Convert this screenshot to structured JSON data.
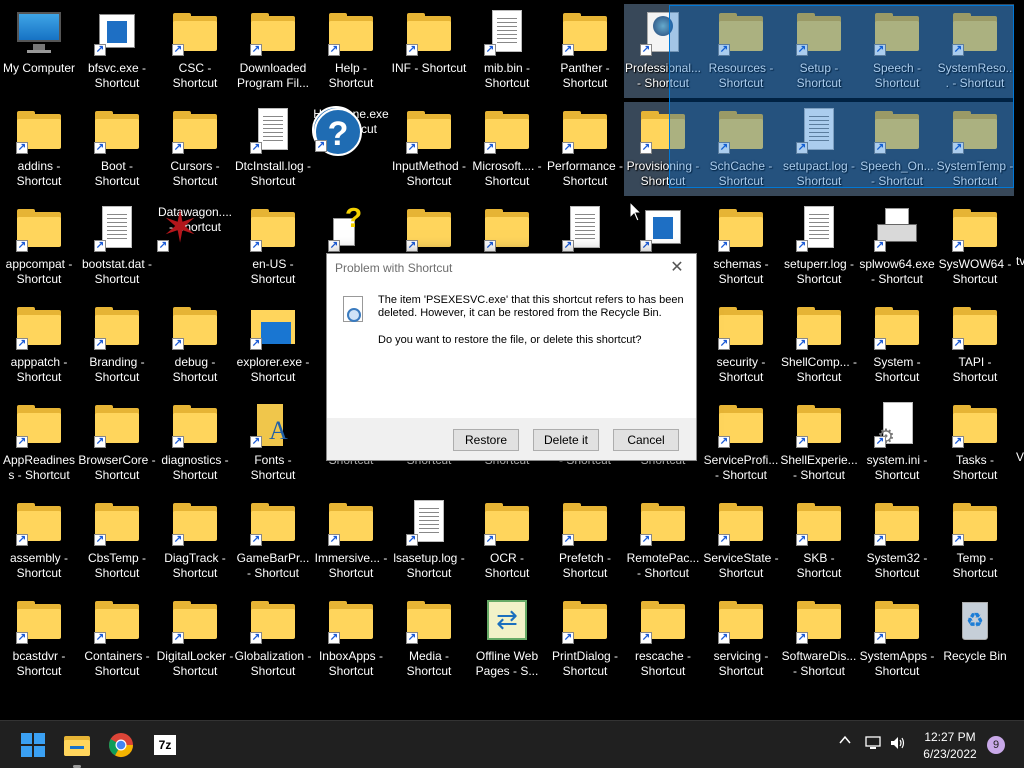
{
  "desktop": {
    "icons": [
      {
        "label": "My Computer",
        "kind": "mycomp",
        "shortcut": false
      },
      {
        "label": "bfsvc.exe - Shortcut",
        "kind": "appwin",
        "shortcut": true
      },
      {
        "label": "CSC - Shortcut",
        "kind": "folder",
        "shortcut": true
      },
      {
        "label": "Downloaded Program Fil...",
        "kind": "folder",
        "shortcut": true
      },
      {
        "label": "Help - Shortcut",
        "kind": "folder",
        "shortcut": true
      },
      {
        "label": "INF - Shortcut",
        "kind": "folder",
        "shortcut": true
      },
      {
        "label": "mib.bin - Shortcut",
        "kind": "doc",
        "shortcut": true
      },
      {
        "label": "Panther - Shortcut",
        "kind": "folder",
        "shortcut": true
      },
      {
        "label": "Professional... - Shortcut",
        "kind": "globe",
        "shortcut": true,
        "selected": true
      },
      {
        "label": "Resources - Shortcut",
        "kind": "folder",
        "shortcut": true,
        "selected": true
      },
      {
        "label": "Setup - Shortcut",
        "kind": "folder",
        "shortcut": true,
        "selected": true
      },
      {
        "label": "Speech - Shortcut",
        "kind": "folder",
        "shortcut": true,
        "selected": true
      },
      {
        "label": "SystemReso... - Shortcut",
        "kind": "folder",
        "shortcut": true,
        "selected": true
      },
      {
        "label": "addins - Shortcut",
        "kind": "folder",
        "shortcut": true
      },
      {
        "label": "Boot - Shortcut",
        "kind": "folder",
        "shortcut": true
      },
      {
        "label": "Cursors - Shortcut",
        "kind": "folder",
        "shortcut": true
      },
      {
        "label": "DtcInstall.log - Shortcut",
        "kind": "doc",
        "shortcut": true
      },
      {
        "label": "HelpPane.exe - Shortcut",
        "kind": "helpq",
        "shortcut": true
      },
      {
        "label": "InputMethod - Shortcut",
        "kind": "folder",
        "shortcut": true
      },
      {
        "label": "Microsoft.... - Shortcut",
        "kind": "folder",
        "shortcut": true
      },
      {
        "label": "Performance - Shortcut",
        "kind": "folder",
        "shortcut": true
      },
      {
        "label": "Provisioning - Shortcut",
        "kind": "folder",
        "shortcut": true,
        "selected": true
      },
      {
        "label": "SchCache - Shortcut",
        "kind": "folder",
        "shortcut": true,
        "selected": true
      },
      {
        "label": "setupact.log - Shortcut",
        "kind": "doc",
        "shortcut": true,
        "selected": true
      },
      {
        "label": "Speech_On... - Shortcut",
        "kind": "folder",
        "shortcut": true,
        "selected": true
      },
      {
        "label": "SystemTemp - Shortcut",
        "kind": "folder",
        "shortcut": true,
        "selected": true
      },
      {
        "label": "appcompat - Shortcut",
        "kind": "folder",
        "shortcut": true
      },
      {
        "label": "bootstat.dat - Shortcut",
        "kind": "doc",
        "shortcut": true
      },
      {
        "label": "Datawagon.... - Shortcut",
        "kind": "star",
        "shortcut": true
      },
      {
        "label": "en-US - Shortcut",
        "kind": "folder",
        "shortcut": true
      },
      {
        "label": "",
        "kind": "helpdoc",
        "shortcut": true
      },
      {
        "label": "",
        "kind": "folder",
        "shortcut": true
      },
      {
        "label": "",
        "kind": "folder",
        "shortcut": true
      },
      {
        "label": "",
        "kind": "doc",
        "shortcut": true
      },
      {
        "label": "e",
        "kind": "appwin",
        "shortcut": true
      },
      {
        "label": "schemas - Shortcut",
        "kind": "folder",
        "shortcut": true
      },
      {
        "label": "setuperr.log - Shortcut",
        "kind": "doc",
        "shortcut": true
      },
      {
        "label": "splwow64.exe - Shortcut",
        "kind": "printer",
        "shortcut": true
      },
      {
        "label": "SysWOW64 - Shortcut",
        "kind": "folder",
        "shortcut": true
      },
      {
        "label": "apppatch - Shortcut",
        "kind": "folder",
        "shortcut": true
      },
      {
        "label": "Branding - Shortcut",
        "kind": "folder",
        "shortcut": true
      },
      {
        "label": "debug - Shortcut",
        "kind": "folder",
        "shortcut": true
      },
      {
        "label": "explorer.exe - Shortcut",
        "kind": "explorer",
        "shortcut": true
      },
      {
        "label": "Id",
        "kind": "none",
        "shortcut": false
      },
      {
        "label": "",
        "kind": "none",
        "shortcut": false
      },
      {
        "label": "",
        "kind": "none",
        "shortcut": false
      },
      {
        "label": "",
        "kind": "none",
        "shortcut": false
      },
      {
        "label": "",
        "kind": "none",
        "shortcut": false
      },
      {
        "label": "security - Shortcut",
        "kind": "folder",
        "shortcut": true
      },
      {
        "label": "ShellComp... - Shortcut",
        "kind": "folder",
        "shortcut": true
      },
      {
        "label": "System - Shortcut",
        "kind": "folder",
        "shortcut": true
      },
      {
        "label": "TAPI - Shortcut",
        "kind": "folder",
        "shortcut": true
      },
      {
        "label": "AppReadiness - Shortcut",
        "kind": "folder",
        "shortcut": true
      },
      {
        "label": "BrowserCore - Shortcut",
        "kind": "folder",
        "shortcut": true
      },
      {
        "label": "diagnostics - Shortcut",
        "kind": "folder",
        "shortcut": true
      },
      {
        "label": "Fonts - Shortcut",
        "kind": "fonts",
        "shortcut": true
      },
      {
        "label": "Shortcut",
        "kind": "none",
        "shortcut": false
      },
      {
        "label": "Shortcut",
        "kind": "none",
        "shortcut": false
      },
      {
        "label": "Shortcut",
        "kind": "none",
        "shortcut": false
      },
      {
        "label": "- Shortcut",
        "kind": "none",
        "shortcut": false
      },
      {
        "label": "Shortcut",
        "kind": "none",
        "shortcut": false
      },
      {
        "label": "ServiceProfi... - Shortcut",
        "kind": "folder",
        "shortcut": true
      },
      {
        "label": "ShellExperie... - Shortcut",
        "kind": "folder",
        "shortcut": true
      },
      {
        "label": "system.ini - Shortcut",
        "kind": "ini",
        "shortcut": true
      },
      {
        "label": "Tasks - Shortcut",
        "kind": "folder",
        "shortcut": true
      },
      {
        "label": "assembly - Shortcut",
        "kind": "folder",
        "shortcut": true
      },
      {
        "label": "CbsTemp - Shortcut",
        "kind": "folder",
        "shortcut": true
      },
      {
        "label": "DiagTrack - Shortcut",
        "kind": "folder",
        "shortcut": true
      },
      {
        "label": "GameBarPr... - Shortcut",
        "kind": "folder",
        "shortcut": true
      },
      {
        "label": "Immersive... - Shortcut",
        "kind": "folder",
        "shortcut": true
      },
      {
        "label": "lsasetup.log - Shortcut",
        "kind": "doc",
        "shortcut": true
      },
      {
        "label": "OCR - Shortcut",
        "kind": "folder",
        "shortcut": true
      },
      {
        "label": "Prefetch - Shortcut",
        "kind": "folder",
        "shortcut": true
      },
      {
        "label": "RemotePac... - Shortcut",
        "kind": "folder",
        "shortcut": true
      },
      {
        "label": "ServiceState - Shortcut",
        "kind": "folder",
        "shortcut": true
      },
      {
        "label": "SKB - Shortcut",
        "kind": "folder",
        "shortcut": true
      },
      {
        "label": "System32 - Shortcut",
        "kind": "folder",
        "shortcut": true
      },
      {
        "label": "Temp - Shortcut",
        "kind": "folder",
        "shortcut": true
      },
      {
        "label": "bcastdvr - Shortcut",
        "kind": "folder",
        "shortcut": true
      },
      {
        "label": "Containers - Shortcut",
        "kind": "folder",
        "shortcut": true
      },
      {
        "label": "DigitalLocker - Shortcut",
        "kind": "folder",
        "shortcut": true
      },
      {
        "label": "Globalization - Shortcut",
        "kind": "folder",
        "shortcut": true
      },
      {
        "label": "InboxApps - Shortcut",
        "kind": "folder",
        "shortcut": true
      },
      {
        "label": "Media - Shortcut",
        "kind": "folder",
        "shortcut": true
      },
      {
        "label": "Offline Web Pages - S...",
        "kind": "offline",
        "shortcut": false
      },
      {
        "label": "PrintDialog - Shortcut",
        "kind": "folder",
        "shortcut": true
      },
      {
        "label": "rescache - Shortcut",
        "kind": "folder",
        "shortcut": true
      },
      {
        "label": "servicing - Shortcut",
        "kind": "folder",
        "shortcut": true
      },
      {
        "label": "SoftwareDis... - Shortcut",
        "kind": "folder",
        "shortcut": true
      },
      {
        "label": "SystemApps - Shortcut",
        "kind": "folder",
        "shortcut": true
      },
      {
        "label": "Recycle Bin",
        "kind": "recycle",
        "shortcut": false
      }
    ],
    "edge_labels": [
      "tv",
      "V"
    ]
  },
  "dialog": {
    "title": "Problem with Shortcut",
    "message": "The item 'PSEXESVC.exe' that this shortcut refers to has been deleted. However, it can be restored from the Recycle Bin.",
    "question": "Do you want to restore the file, or delete this shortcut?",
    "buttons": {
      "restore": "Restore",
      "delete": "Delete it",
      "cancel": "Cancel"
    },
    "close_glyph": "✕"
  },
  "taskbar": {
    "apps": [
      "start-icon",
      "file-explorer-icon",
      "chrome-icon",
      "7zip-icon"
    ],
    "sevenzip_label": "7z",
    "time": "12:27 PM",
    "date": "6/23/2022",
    "notification_count": "9",
    "tray_chevron": "^"
  },
  "colors": {
    "folder": "#ffd55c",
    "selection": "#0078d7",
    "taskbar": "#202020"
  }
}
